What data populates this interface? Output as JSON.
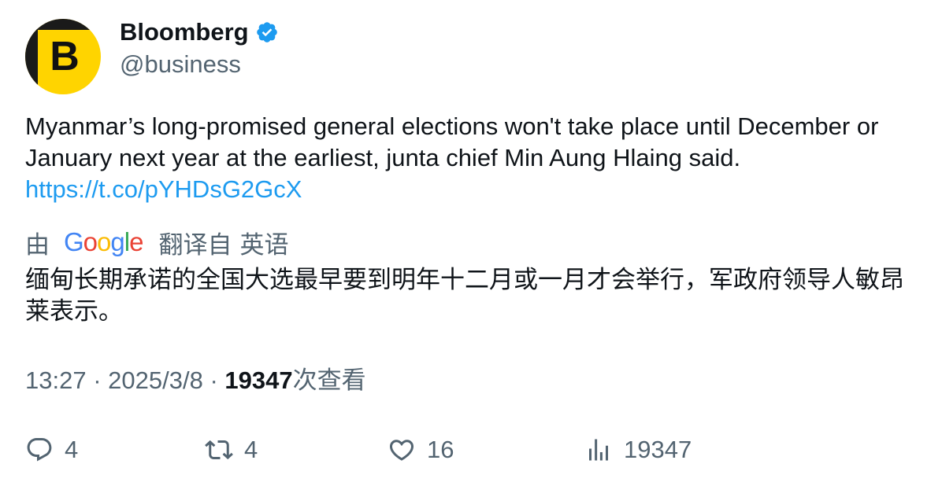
{
  "author": {
    "avatar_letter": "B",
    "display_name": "Bloomberg",
    "handle": "@business",
    "verified": true
  },
  "tweet": {
    "text": "Myanmar’s long-promised general elections won't take place until December or January next year at the earliest, junta chief Min Aung Hlaing said.",
    "link": "https://t.co/pYHDsG2GcX"
  },
  "translation": {
    "by_label": "由",
    "provider_letters": [
      "G",
      "o",
      "o",
      "g",
      "l",
      "e"
    ],
    "translated_from_label": "翻译自",
    "source_language": "英语",
    "text": "缅甸长期承诺的全国大选最早要到明年十二月或一月才会举行，军政府领导人敏昂莱表示。"
  },
  "meta": {
    "time": "13:27",
    "separator": "·",
    "date": "2025/3/8",
    "views_count": "19347",
    "views_label": "次查看"
  },
  "actions": {
    "replies": "4",
    "retweets": "4",
    "likes": "16",
    "views": "19347"
  },
  "colors": {
    "link": "#1d9bf0",
    "secondary_text": "#536471",
    "verified": "#1d9bf0",
    "avatar_bg": "#ffd400"
  }
}
